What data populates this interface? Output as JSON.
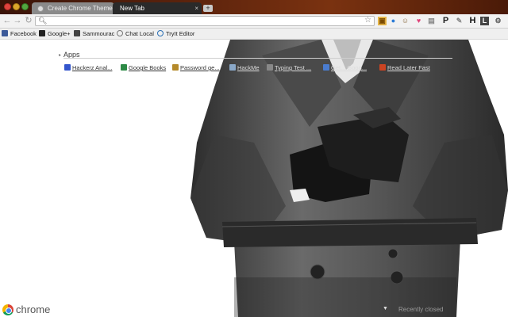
{
  "window": {
    "tabs": [
      {
        "label": "Create Chrome Theme Onlin",
        "active": false
      },
      {
        "label": "New Tab",
        "active": true
      }
    ]
  },
  "toolbar": {
    "back": "←",
    "forward": "→",
    "reload": "↻",
    "omnibox_value": "",
    "extensions": [
      "P",
      "H"
    ]
  },
  "bookmarks": [
    {
      "label": "Facebook",
      "icon": "facebook-icon",
      "color": "#3b5998"
    },
    {
      "label": "Google+",
      "icon": "google-plus-icon",
      "color": "#222222"
    },
    {
      "label": "Sammourac",
      "icon": "sammourac-icon",
      "color": "#444444"
    },
    {
      "label": "Chat Local",
      "icon": "chat-icon",
      "color": "#777777"
    },
    {
      "label": "TryIt Editor",
      "icon": "tryit-icon",
      "color": "#2a6fb5"
    }
  ],
  "apps": {
    "heading": "Apps",
    "items": [
      {
        "label": "Hackerz Anal...",
        "color": "#3355cc"
      },
      {
        "label": "Google Books",
        "color": "#2d8a46"
      },
      {
        "label": "Password ge...",
        "color": "#b58a2a"
      },
      {
        "label": "HackMe",
        "color": "#8aa8c8"
      },
      {
        "label": "Typing Test ...",
        "color": "#888888"
      },
      {
        "label": "Get... Goog...",
        "color": "#4a7ccf"
      },
      {
        "label": "Read Later Fast",
        "color": "#cc4422"
      }
    ]
  },
  "footer": {
    "logo": "chrome",
    "recently_closed": "Recently closed"
  }
}
